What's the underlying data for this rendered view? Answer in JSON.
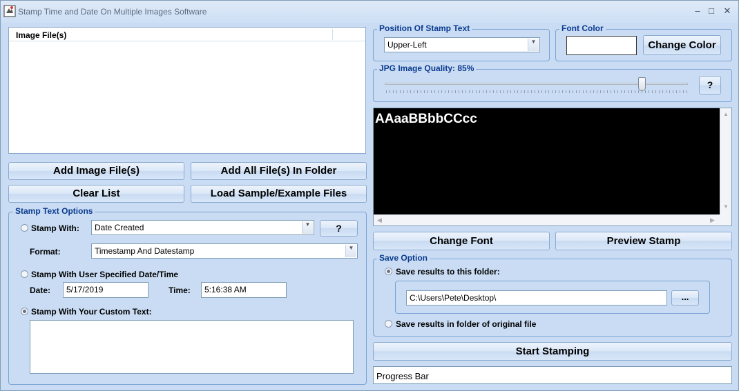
{
  "window": {
    "title": "Stamp Time and Date On Multiple Images Software",
    "minimize": "–",
    "maximize": "□",
    "close": "✕"
  },
  "file_list": {
    "column_header": "Image File(s)",
    "rows": []
  },
  "buttons": {
    "add_files": "Add Image File(s)",
    "add_folder": "Add All File(s) In Folder",
    "clear_list": "Clear List",
    "load_sample": "Load Sample/Example Files",
    "change_color": "Change Color",
    "quality_help": "?",
    "change_font": "Change Font",
    "preview_stamp": "Preview Stamp",
    "browse": "...",
    "start_stamping": "Start Stamping",
    "stamp_with_help": "?"
  },
  "stamp_options": {
    "legend": "Stamp Text Options",
    "stamp_with_label": "Stamp With:",
    "stamp_with_value": "Date Created",
    "format_label": "Format:",
    "format_value": "Timestamp And Datestamp",
    "user_date_label": "Stamp With User Specified Date/Time",
    "date_label": "Date:",
    "date_value": "5/17/2019",
    "time_label": "Time:",
    "time_value": "5:16:38 AM",
    "custom_text_label": "Stamp With Your Custom Text:",
    "custom_text_value": "",
    "selected_mode": "custom"
  },
  "position": {
    "legend": "Position Of Stamp Text",
    "value": "Upper-Left"
  },
  "font_color": {
    "legend": "Font Color",
    "swatch": "#ffffff"
  },
  "quality": {
    "legend": "JPG Image Quality: 85%",
    "value_percent": 85
  },
  "preview": {
    "sample_text": "AAaaBBbbCCcc",
    "background": "#000000",
    "text_color": "#ffffff"
  },
  "save_option": {
    "legend": "Save Option",
    "to_folder_label": "Save results to this folder:",
    "folder_path": "C:\\Users\\Pete\\Desktop\\",
    "original_folder_label": "Save results in folder of original file",
    "selected": "folder"
  },
  "progress": {
    "label": "Progress Bar"
  },
  "colors": {
    "window_bg": "#c9dcf3",
    "accent_text": "#0b3b8f"
  }
}
